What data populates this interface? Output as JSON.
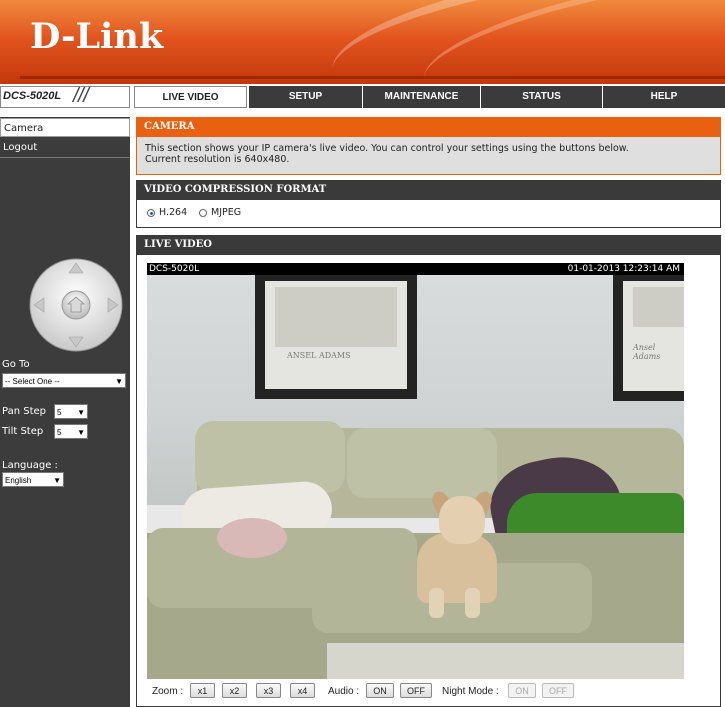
{
  "header": {
    "logo": "D-Link"
  },
  "nav": {
    "model": "DCS-5020L",
    "tabs": [
      {
        "label": "LIVE VIDEO",
        "active": true
      },
      {
        "label": "SETUP",
        "active": false
      },
      {
        "label": "MAINTENANCE",
        "active": false
      },
      {
        "label": "STATUS",
        "active": false
      },
      {
        "label": "HELP",
        "active": false
      }
    ]
  },
  "sidebar": {
    "items": [
      {
        "label": "Camera",
        "active": true
      },
      {
        "label": "Logout",
        "active": false
      }
    ],
    "goto_label": "Go To",
    "goto_value": "-- Select One --",
    "pan_step_label": "Pan Step",
    "pan_step_value": "5",
    "tilt_step_label": "Tilt Step",
    "tilt_step_value": "5",
    "language_label": "Language :",
    "language_value": "English"
  },
  "camera_section": {
    "title": "CAMERA",
    "description_line1": "This section shows your IP camera's live video. You can control your settings using the buttons below.",
    "description_line2": "Current resolution is 640x480."
  },
  "compression_section": {
    "title": "VIDEO COMPRESSION FORMAT",
    "options": [
      {
        "label": "H.264",
        "selected": true
      },
      {
        "label": "MJPEG",
        "selected": false
      }
    ]
  },
  "live_video_section": {
    "title": "LIVE VIDEO",
    "osd_left": "DCS-5020L",
    "osd_right": "01-01-2013 12:23:14 AM",
    "frame_text_1": "ANSEL ADAMS",
    "frame_text_2": "Ansel Adams"
  },
  "controls": {
    "zoom_label": "Zoom :",
    "zoom_buttons": [
      "x1",
      "x2",
      "x3",
      "x4"
    ],
    "audio_label": "Audio :",
    "audio_on": "ON",
    "audio_off": "OFF",
    "night_label": "Night Mode :",
    "night_on": "ON",
    "night_off": "OFF"
  },
  "colors": {
    "brand_orange": "#e86010",
    "dark_bar": "#3a3a3a"
  }
}
